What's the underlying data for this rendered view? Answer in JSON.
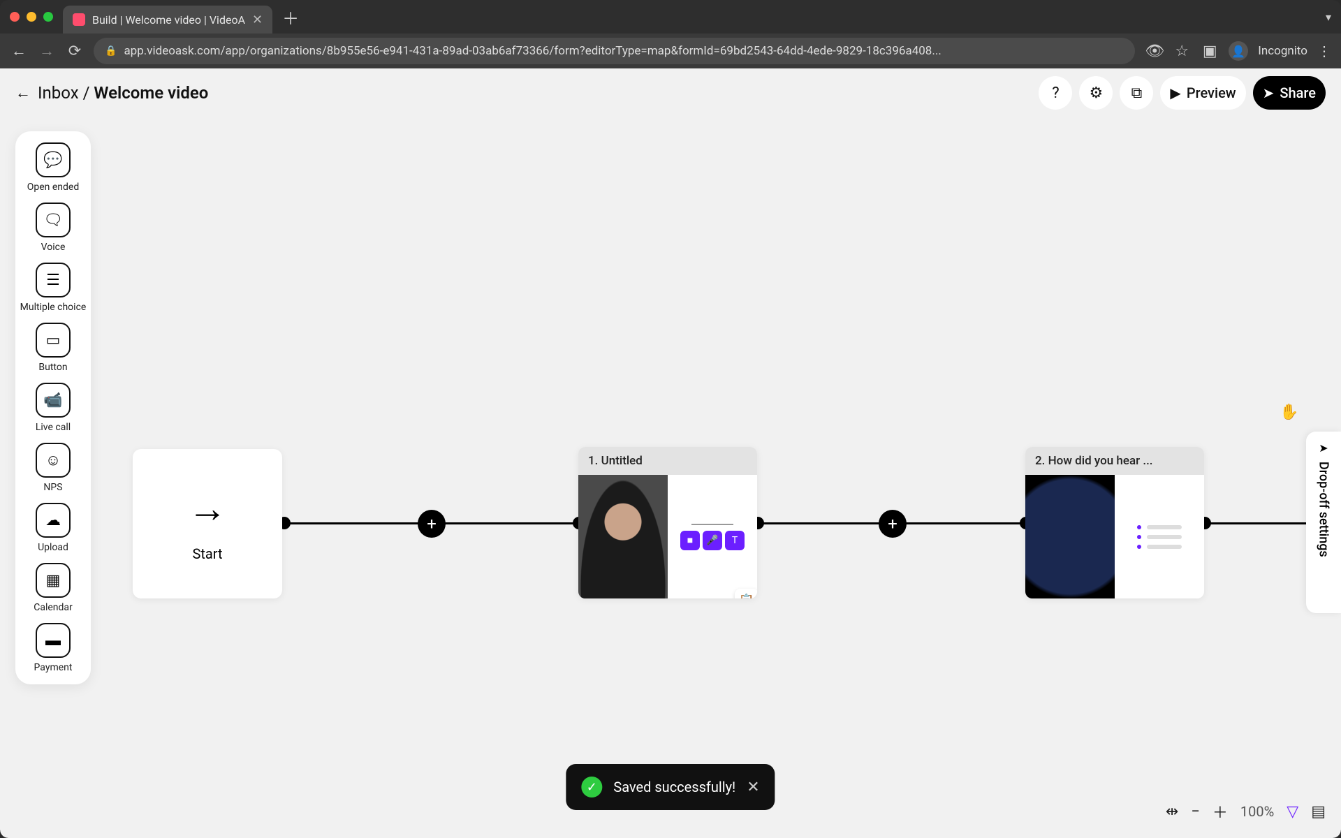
{
  "browser": {
    "tab_title": "Build | Welcome video | VideoA",
    "url": "app.videoask.com/app/organizations/8b955e56-e941-431a-89ad-03ab6af73366/form?editorType=map&formId=69bd2543-64dd-4ede-9829-18c396a408...",
    "incognito_label": "Incognito"
  },
  "header": {
    "back_label": "Inbox",
    "separator": " / ",
    "title": "Welcome video",
    "preview_label": "Preview",
    "share_label": "Share"
  },
  "palette": [
    {
      "label": "Open ended",
      "icon": "speech"
    },
    {
      "label": "Voice",
      "icon": "voice"
    },
    {
      "label": "Multiple choice",
      "icon": "list"
    },
    {
      "label": "Button",
      "icon": "button"
    },
    {
      "label": "Live call",
      "icon": "livecall"
    },
    {
      "label": "NPS",
      "icon": "smile"
    },
    {
      "label": "Upload",
      "icon": "upload"
    },
    {
      "label": "Calendar",
      "icon": "calendar"
    },
    {
      "label": "Payment",
      "icon": "payment"
    }
  ],
  "canvas": {
    "start_label": "Start",
    "nodes": [
      {
        "title": "1. Untitled",
        "thumb": "person",
        "type": "open_ended",
        "has_clip": true
      },
      {
        "title": "2. How did you hear ...",
        "thumb": "earth",
        "type": "multiple_choice",
        "has_clip": false
      }
    ]
  },
  "dropoff_label": "Drop-off settings",
  "toast": {
    "message": "Saved successfully!"
  },
  "footer": {
    "zoom": "100%"
  },
  "colors": {
    "accent": "#6b1fff"
  }
}
